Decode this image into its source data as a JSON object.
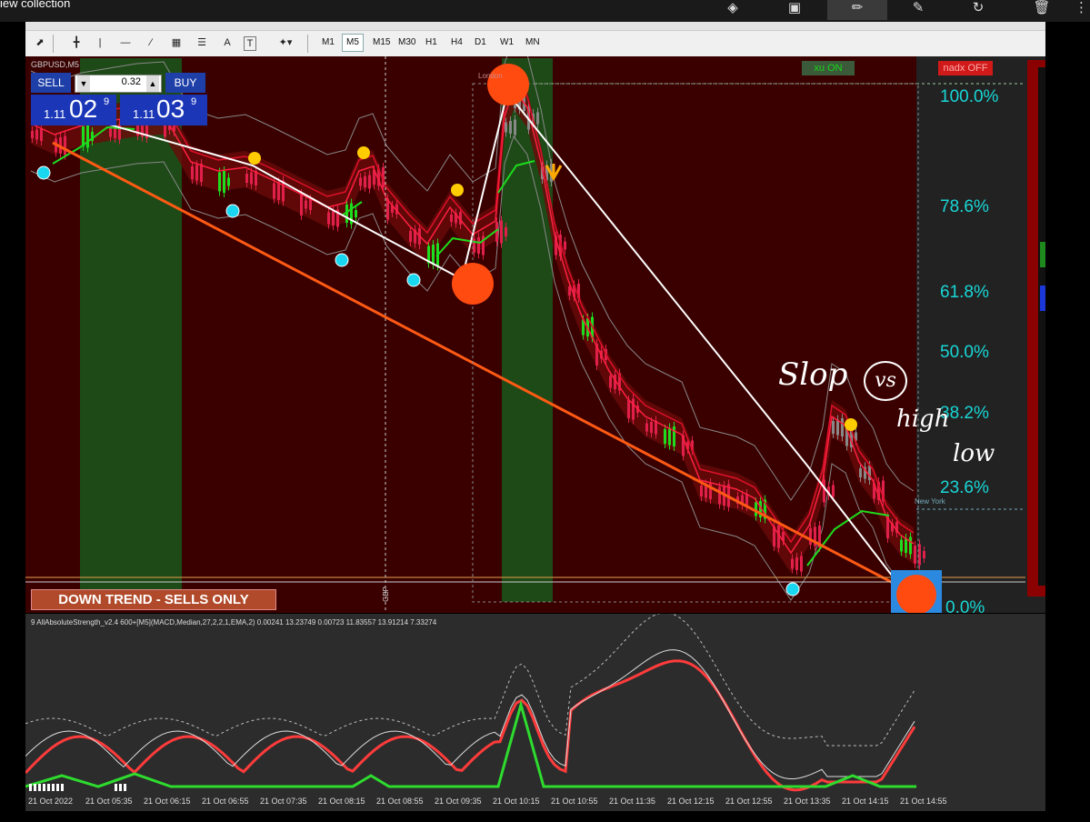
{
  "window": {
    "title": "iew collection",
    "icons": [
      "brush-icon",
      "image-icon",
      "pen-icon",
      "pencil-icon",
      "history-icon",
      "trash-icon",
      "more-icon"
    ]
  },
  "toolbar": {
    "tools": [
      "cursor-icon",
      "crosshair-icon",
      "vertical-line-icon",
      "horizontal-line-icon",
      "trendline-icon",
      "channel-icon",
      "fibo-icon",
      "text-icon",
      "label-icon",
      "shapes-icon"
    ],
    "text_tool": "A",
    "label_tool": "T",
    "timeframes": [
      "M1",
      "M5",
      "M15",
      "M30",
      "H1",
      "H4",
      "D1",
      "W1",
      "MN"
    ],
    "selected_timeframe": "M5"
  },
  "chart": {
    "symbol": "GBPUSD,M5",
    "xu_button": "xu ON",
    "nadx_button": "nadx OFF",
    "session_london": "London",
    "session_new_york": "New York",
    "currency_marker": "GBP",
    "banner": "DOWN TREND - SELLS ONLY",
    "fib_levels": [
      "100.0%",
      "78.6%",
      "61.8%",
      "50.0%",
      "38.2%",
      "23.6%",
      "0.0%"
    ]
  },
  "trade": {
    "sell_label": "SELL",
    "buy_label": "BUY",
    "lot": "0.32",
    "sell_prefix": "1.11",
    "sell_big": "02",
    "sell_sup": "9",
    "buy_prefix": "1.11",
    "buy_big": "03",
    "buy_sup": "9"
  },
  "annotations": {
    "line1": "Slop",
    "circled": "vs",
    "line2": "high",
    "line3": "low"
  },
  "indicator": {
    "title": "9 AllAbsoluteStrength_v2.4 600+[M5](MACD,Median,27,2,2,1,EMA,2) 0.00241 13.23749 0.00723 11.83557 13.91214 7.33274"
  },
  "xaxis": {
    "labels": [
      "21 Oct 2022",
      "21 Oct 05:35",
      "21 Oct 06:15",
      "21 Oct 06:55",
      "21 Oct 07:35",
      "21 Oct 08:15",
      "21 Oct 08:55",
      "21 Oct 09:35",
      "21 Oct 10:15",
      "21 Oct 10:55",
      "21 Oct 11:35",
      "21 Oct 12:15",
      "21 Oct 12:55",
      "21 Oct 13:35",
      "21 Oct 14:15",
      "21 Oct 14:55"
    ]
  },
  "colors": {
    "chart_bg": "#3a0000",
    "green_zone": "#1e4a17",
    "fib_text": "#19d7d7",
    "trendline": "#ff5a14",
    "bull_candle": "#1edc1e",
    "bear_candle": "#e0204a"
  }
}
